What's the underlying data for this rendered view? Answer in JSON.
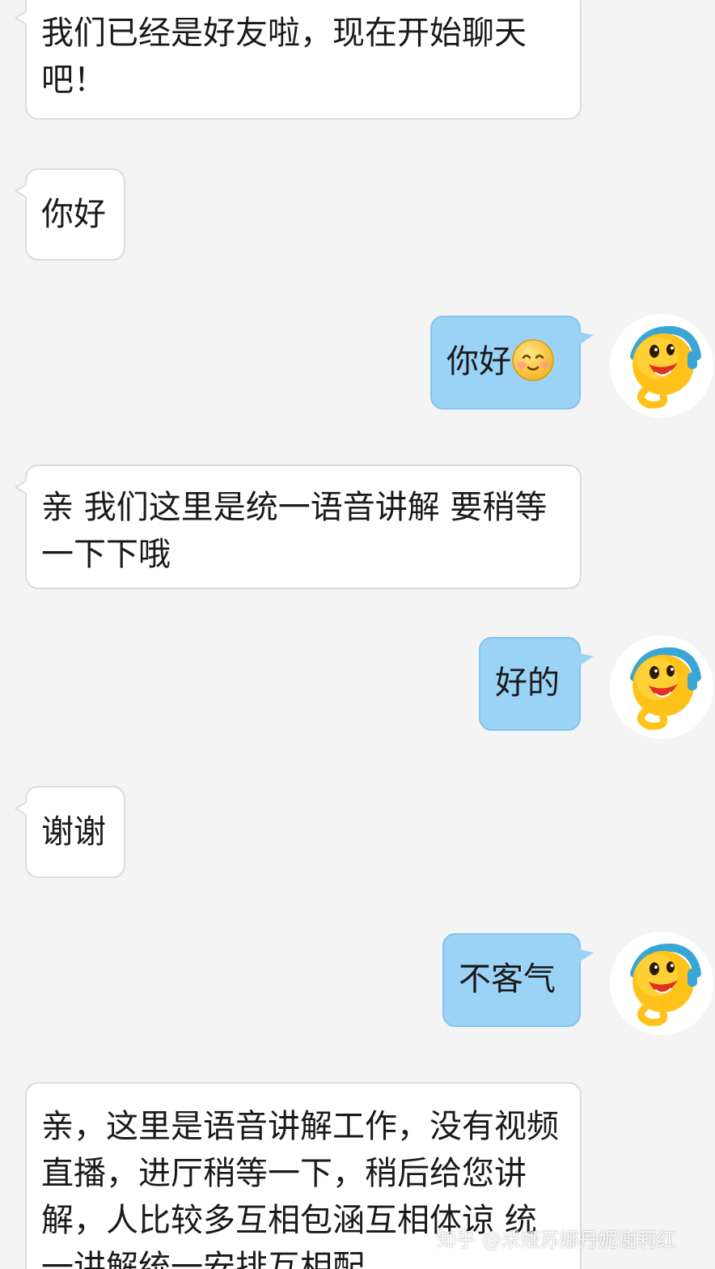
{
  "messages": [
    {
      "side": "in",
      "text": "我们已经是好友啦，现在开始聊天吧！"
    },
    {
      "side": "in",
      "text": "你好"
    },
    {
      "side": "out",
      "text": "你好",
      "emoji": "blush-smile-emoji"
    },
    {
      "side": "in",
      "text": "亲 我们这里是统一语音讲解 要稍等一下下哦"
    },
    {
      "side": "out",
      "text": "好的"
    },
    {
      "side": "in",
      "text": "谢谢"
    },
    {
      "side": "out",
      "text": "不客气"
    },
    {
      "side": "in",
      "text": "亲，这里是语音讲解工作，没有视频直播，进厅稍等一下，稍后给您讲解，人比较多互相包涵互相体谅 统一讲解统一安排互相配"
    }
  ],
  "avatar_icon": "qq-penguin-avatar-icon",
  "watermark": "知乎 @米娅苏娜丹妮谢莉红",
  "colors": {
    "background": "#f4f4f4",
    "incoming_bubble": "#ffffff",
    "outgoing_bubble": "#9bd3f7"
  }
}
